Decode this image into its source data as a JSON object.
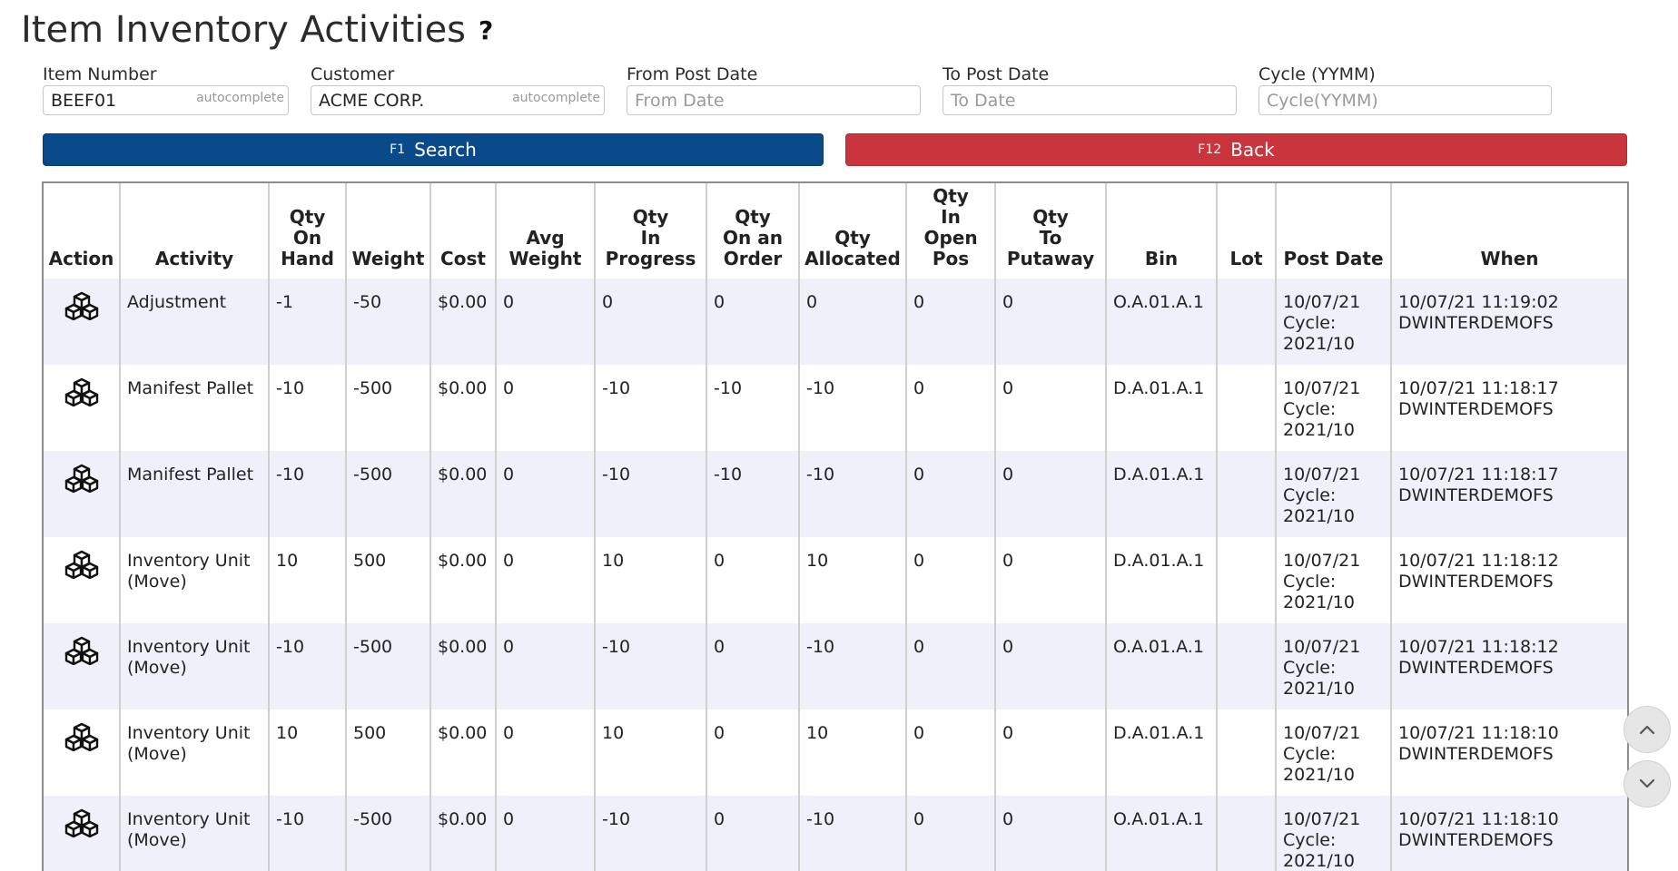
{
  "page": {
    "title": "Item Inventory Activities",
    "help_symbol": "?"
  },
  "filters": {
    "item_number": {
      "label": "Item Number",
      "value": "BEEF01",
      "hint": "autocomplete"
    },
    "customer": {
      "label": "Customer",
      "value": "ACME CORP.",
      "hint": "autocomplete"
    },
    "from_post_date": {
      "label": "From Post Date",
      "placeholder": "From Date",
      "value": ""
    },
    "to_post_date": {
      "label": "To Post Date",
      "placeholder": "To Date",
      "value": ""
    },
    "cycle": {
      "label": "Cycle (YYMM)",
      "placeholder": "Cycle(YYMM)",
      "value": ""
    }
  },
  "buttons": {
    "search": {
      "key": "F1",
      "label": "Search",
      "color": "#0a4a8a"
    },
    "back": {
      "key": "F12",
      "label": "Back",
      "color": "#c9343d"
    }
  },
  "table": {
    "headers": {
      "action": "Action",
      "activity": "Activity",
      "qty_on_hand": [
        "Qty",
        "On",
        "Hand"
      ],
      "weight": "Weight",
      "cost": "Cost",
      "avg_weight": [
        "Avg",
        "Weight"
      ],
      "qty_in_progress": [
        "Qty",
        "In",
        "Progress"
      ],
      "qty_on_order": [
        "Qty",
        "On an",
        "Order"
      ],
      "qty_allocated": [
        "Qty",
        "Allocated"
      ],
      "qty_open_pos": [
        "Qty",
        "In",
        "Open",
        "Pos"
      ],
      "qty_putaway": [
        "Qty",
        "To",
        "Putaway"
      ],
      "bin": "Bin",
      "lot": "Lot",
      "post_date": "Post Date",
      "when": "When"
    },
    "rows": [
      {
        "action_icon": "cubes-icon",
        "activity": [
          "Adjustment"
        ],
        "qty_on_hand": "-1",
        "weight": "-50",
        "cost": "$0.00",
        "avg_weight": "0",
        "qty_in_progress": "0",
        "qty_on_order": "0",
        "qty_allocated": "0",
        "qty_open_pos": "0",
        "qty_putaway": "0",
        "bin": "O.A.01.A.1",
        "lot": "",
        "post_date": [
          "10/07/21",
          "Cycle:",
          "2021/10"
        ],
        "when": [
          "10/07/21 11:19:02",
          "DWINTERDEMOFS"
        ]
      },
      {
        "action_icon": "cubes-icon",
        "activity": [
          "Manifest Pallet"
        ],
        "qty_on_hand": "-10",
        "weight": "-500",
        "cost": "$0.00",
        "avg_weight": "0",
        "qty_in_progress": "-10",
        "qty_on_order": "-10",
        "qty_allocated": "-10",
        "qty_open_pos": "0",
        "qty_putaway": "0",
        "bin": "D.A.01.A.1",
        "lot": "",
        "post_date": [
          "10/07/21",
          "Cycle:",
          "2021/10"
        ],
        "when": [
          "10/07/21 11:18:17",
          "DWINTERDEMOFS"
        ]
      },
      {
        "action_icon": "cubes-icon",
        "activity": [
          "Manifest Pallet"
        ],
        "qty_on_hand": "-10",
        "weight": "-500",
        "cost": "$0.00",
        "avg_weight": "0",
        "qty_in_progress": "-10",
        "qty_on_order": "-10",
        "qty_allocated": "-10",
        "qty_open_pos": "0",
        "qty_putaway": "0",
        "bin": "D.A.01.A.1",
        "lot": "",
        "post_date": [
          "10/07/21",
          "Cycle:",
          "2021/10"
        ],
        "when": [
          "10/07/21 11:18:17",
          "DWINTERDEMOFS"
        ]
      },
      {
        "action_icon": "cubes-icon",
        "activity": [
          "Inventory Unit",
          "(Move)"
        ],
        "qty_on_hand": "10",
        "weight": "500",
        "cost": "$0.00",
        "avg_weight": "0",
        "qty_in_progress": "10",
        "qty_on_order": "0",
        "qty_allocated": "10",
        "qty_open_pos": "0",
        "qty_putaway": "0",
        "bin": "D.A.01.A.1",
        "lot": "",
        "post_date": [
          "10/07/21",
          "Cycle:",
          "2021/10"
        ],
        "when": [
          "10/07/21 11:18:12",
          "DWINTERDEMOFS"
        ]
      },
      {
        "action_icon": "cubes-icon",
        "activity": [
          "Inventory Unit",
          "(Move)"
        ],
        "qty_on_hand": "-10",
        "weight": "-500",
        "cost": "$0.00",
        "avg_weight": "0",
        "qty_in_progress": "-10",
        "qty_on_order": "0",
        "qty_allocated": "-10",
        "qty_open_pos": "0",
        "qty_putaway": "0",
        "bin": "O.A.01.A.1",
        "lot": "",
        "post_date": [
          "10/07/21",
          "Cycle:",
          "2021/10"
        ],
        "when": [
          "10/07/21 11:18:12",
          "DWINTERDEMOFS"
        ]
      },
      {
        "action_icon": "cubes-icon",
        "activity": [
          "Inventory Unit",
          "(Move)"
        ],
        "qty_on_hand": "10",
        "weight": "500",
        "cost": "$0.00",
        "avg_weight": "0",
        "qty_in_progress": "10",
        "qty_on_order": "0",
        "qty_allocated": "10",
        "qty_open_pos": "0",
        "qty_putaway": "0",
        "bin": "D.A.01.A.1",
        "lot": "",
        "post_date": [
          "10/07/21",
          "Cycle:",
          "2021/10"
        ],
        "when": [
          "10/07/21 11:18:10",
          "DWINTERDEMOFS"
        ]
      },
      {
        "action_icon": "cubes-icon",
        "activity": [
          "Inventory Unit",
          "(Move)"
        ],
        "qty_on_hand": "-10",
        "weight": "-500",
        "cost": "$0.00",
        "avg_weight": "0",
        "qty_in_progress": "-10",
        "qty_on_order": "0",
        "qty_allocated": "-10",
        "qty_open_pos": "0",
        "qty_putaway": "0",
        "bin": "O.A.01.A.1",
        "lot": "",
        "post_date": [
          "10/07/21",
          "Cycle:",
          "2021/10"
        ],
        "when": [
          "10/07/21 11:18:10",
          "DWINTERDEMOFS"
        ]
      }
    ]
  },
  "scroll": {
    "up_icon": "chevron-up-icon",
    "down_icon": "chevron-down-icon"
  }
}
